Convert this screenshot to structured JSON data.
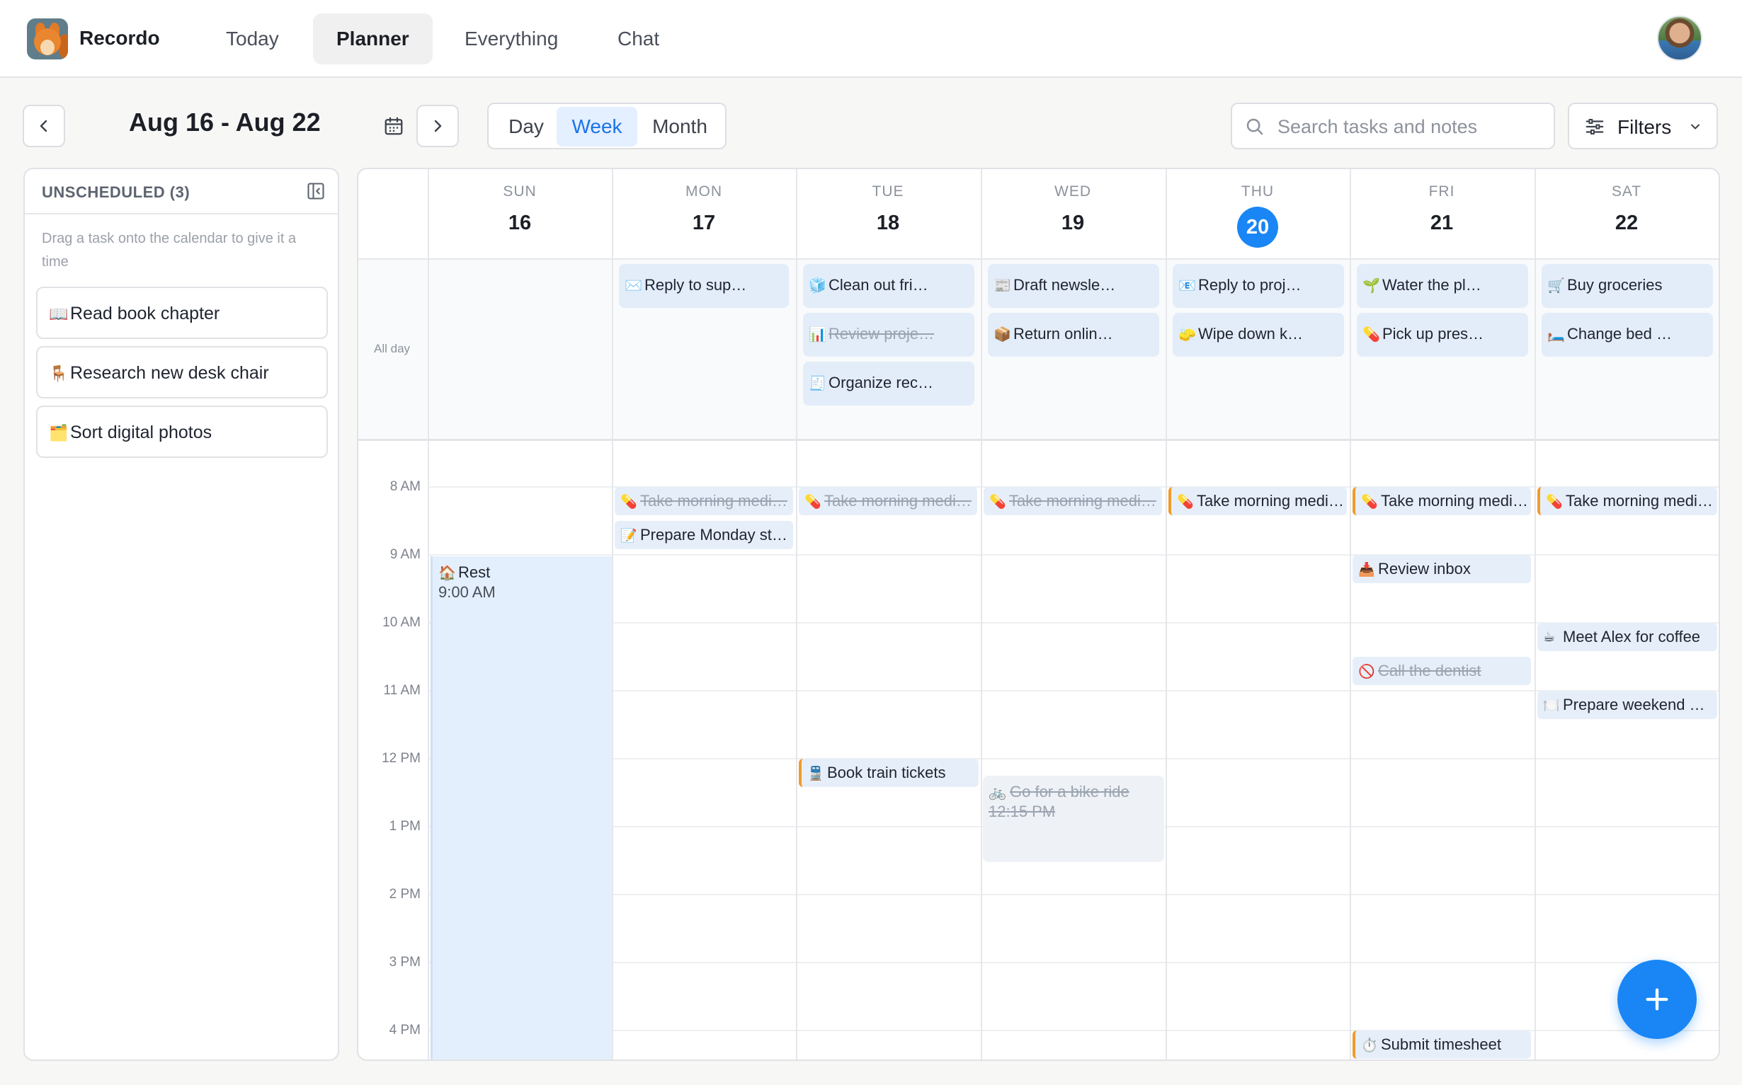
{
  "app": {
    "name": "Recordo"
  },
  "nav": {
    "items": [
      "Today",
      "Planner",
      "Everything",
      "Chat"
    ],
    "active": "Planner"
  },
  "toolbar": {
    "date_range": "Aug 16 - Aug 22",
    "views": [
      "Day",
      "Week",
      "Month"
    ],
    "active_view": "Week",
    "search_placeholder": "Search tasks and notes",
    "filters_label": "Filters"
  },
  "unscheduled": {
    "title": "UNSCHEDULED (3)",
    "hint": "Drag a task onto the calendar to give it a time",
    "tasks": [
      {
        "icon": "📖",
        "label": "Read book chapter"
      },
      {
        "icon": "🪑",
        "label": "Research new desk chair"
      },
      {
        "icon": "🗂️",
        "label": "Sort digital photos"
      }
    ]
  },
  "calendar": {
    "all_day_label": "All day",
    "days": [
      {
        "dow": "SUN",
        "num": "16"
      },
      {
        "dow": "MON",
        "num": "17"
      },
      {
        "dow": "TUE",
        "num": "18"
      },
      {
        "dow": "WED",
        "num": "19"
      },
      {
        "dow": "THU",
        "num": "20",
        "today": true
      },
      {
        "dow": "FRI",
        "num": "21"
      },
      {
        "dow": "SAT",
        "num": "22"
      }
    ],
    "times": [
      "8 AM",
      "9 AM",
      "10 AM",
      "11 AM",
      "12 PM",
      "1 PM",
      "2 PM",
      "3 PM",
      "4 PM"
    ],
    "all_day": {
      "mon": [
        {
          "icon": "✉️",
          "label": "Reply to sup…"
        }
      ],
      "tue": [
        {
          "icon": "🧊",
          "label": "Clean out fri…"
        },
        {
          "icon": "📊",
          "label": "Review proje…",
          "done": true
        },
        {
          "icon": "🧾",
          "label": "Organize rec…"
        }
      ],
      "wed": [
        {
          "icon": "📰",
          "label": "Draft newsle…"
        },
        {
          "icon": "📦",
          "label": "Return onlin…"
        }
      ],
      "thu": [
        {
          "icon": "📧",
          "label": "Reply to proj…"
        },
        {
          "icon": "🧽",
          "label": "Wipe down k…"
        }
      ],
      "fri": [
        {
          "icon": "🌱",
          "label": "Water the pl…"
        },
        {
          "icon": "💊",
          "label": "Pick up pres…"
        }
      ],
      "sat": [
        {
          "icon": "🛒",
          "label": "Buy groceries"
        },
        {
          "icon": "🛏️",
          "label": "Change bed …"
        }
      ]
    },
    "events": {
      "rest": {
        "icon": "🏠",
        "label": "Rest",
        "time": "9:00 AM"
      },
      "meds_mon": {
        "icon": "💊",
        "label": "Take morning medi…",
        "done": true
      },
      "meds_tue": {
        "icon": "💊",
        "label": "Take morning medi…",
        "done": true
      },
      "meds_wed": {
        "icon": "💊",
        "label": "Take morning medi…",
        "done": true
      },
      "meds_thu": {
        "icon": "💊",
        "label": "Take morning medi…"
      },
      "meds_fri": {
        "icon": "💊",
        "label": "Take morning medi…"
      },
      "meds_sat": {
        "icon": "💊",
        "label": "Take morning medi…"
      },
      "prepare_monday": {
        "icon": "📝",
        "label": "Prepare Monday st…"
      },
      "review_inbox": {
        "icon": "📥",
        "label": "Review inbox"
      },
      "coffee": {
        "icon": "☕",
        "label": "Meet Alex for coffee"
      },
      "dentist": {
        "icon": "🚫",
        "label": "Call the dentist",
        "done": true
      },
      "prepare_weekend": {
        "icon": "🍽️",
        "label": "Prepare weekend …"
      },
      "train": {
        "icon": "🚆",
        "label": "Book train tickets"
      },
      "bike": {
        "icon": "🚲",
        "label": "Go for a bike ride",
        "time": "12:15 PM",
        "done": true
      },
      "timesheet": {
        "icon": "⏱️",
        "label": "Submit timesheet"
      }
    }
  },
  "colors": {
    "accent": "#1a86f5",
    "chip": "#e3edf9",
    "orange": "#f09b2c"
  }
}
